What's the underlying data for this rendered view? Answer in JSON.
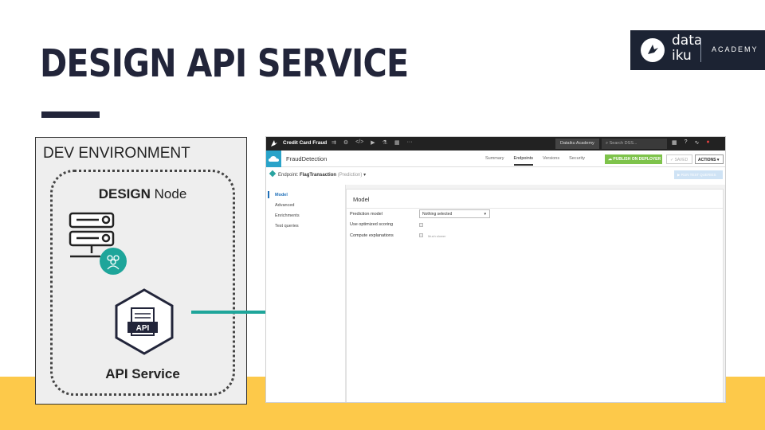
{
  "slide": {
    "title": "DESIGN API SERVICE"
  },
  "logo": {
    "line1": "data",
    "line2": "iku",
    "tagline": "ACADEMY"
  },
  "dev_environment": {
    "label": "DEV ENVIRONMENT",
    "node_bold": "DESIGN",
    "node_rest": " Node",
    "api_icon_text": "API",
    "api_label": "API Service"
  },
  "dss": {
    "topbar": {
      "project": "Credit Card Fraud",
      "icons": [
        "flow-icon",
        "settings-icon",
        "code-icon",
        "run-icon",
        "lab-icon",
        "dashboard-icon",
        "more-icon"
      ],
      "more": "···",
      "instance": "Dataiku Academy",
      "search_placeholder": "Search DSS..."
    },
    "service": {
      "name": "FraudDetection",
      "tabs": [
        "Summary",
        "Endpoints",
        "Versions",
        "Security"
      ],
      "active_tab": "Endpoints",
      "publish": "PUBLISH ON DEPLOYER",
      "saved": "SAVED",
      "actions": "ACTIONS"
    },
    "endpoint": {
      "prefix": "Endpoint: ",
      "name": "FlagTransaction",
      "type": "(Prediction)",
      "run_button": "RUN TEST QUERIES"
    },
    "side_nav": [
      "Model",
      "Advanced",
      "Enrichments",
      "Test queries"
    ],
    "card": {
      "title": "Model",
      "prediction_model_label": "Prediction model",
      "prediction_model_value": "Nothing selected",
      "optimized_scoring_label": "Use optimized scoring",
      "compute_explanations_label": "Compute explanations",
      "compute_explanations_hint": "Much slower"
    }
  },
  "colors": {
    "title": "#22253a",
    "footer_band": "#fdc94a",
    "connector": "#1ea59a",
    "teal_badge": "#1ea59a",
    "publish_button": "#7ec34b"
  }
}
